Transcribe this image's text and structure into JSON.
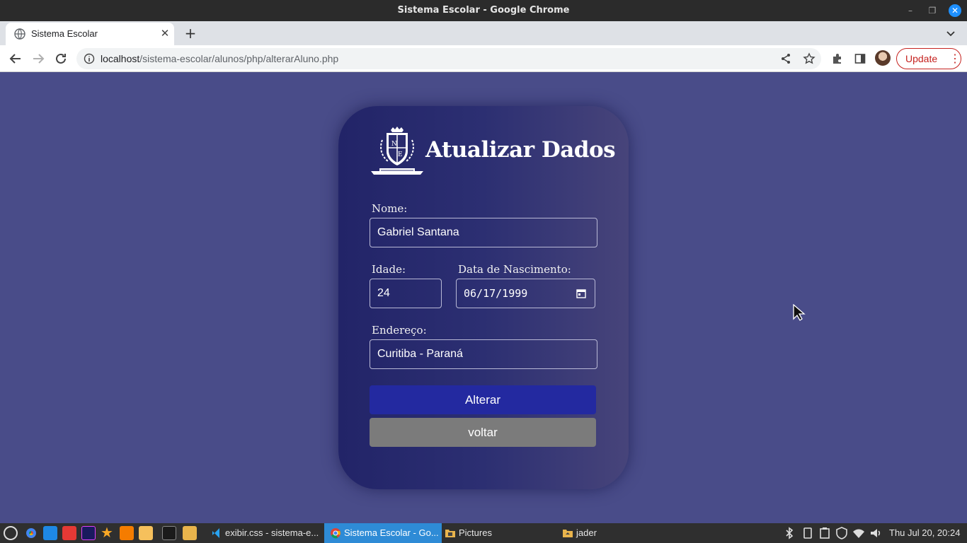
{
  "window": {
    "title": "Sistema Escolar - Google Chrome"
  },
  "browser": {
    "tab_title": "Sistema Escolar",
    "url_host": "localhost",
    "url_path": "/sistema-escolar/alunos/php/alterarAluno.php",
    "update_label": "Update"
  },
  "form": {
    "heading": "Atualizar Dados",
    "nome_label": "Nome:",
    "nome_value": "Gabriel Santana",
    "idade_label": "Idade:",
    "idade_value": "24",
    "nascimento_label": "Data de Nascimento:",
    "nascimento_value": "06/17/1999",
    "endereco_label": "Endereço:",
    "endereco_value": "Curitiba - Paraná",
    "submit_label": "Alterar",
    "back_label": "voltar"
  },
  "taskbar": {
    "tasks": [
      {
        "label": "exibir.css - sistema-e...",
        "icon": "vscode-icon"
      },
      {
        "label": "Sistema Escolar - Go...",
        "icon": "chrome-icon"
      },
      {
        "label": "Pictures",
        "icon": "folder-icon"
      },
      {
        "label": "jader",
        "icon": "folder-icon"
      }
    ],
    "clock": "Thu Jul 20, 20:24"
  },
  "colors": {
    "page_bg": "#494c89",
    "primary_button": "#2329a0",
    "secondary_button": "#7b7b7b",
    "update_accent": "#c5221f"
  }
}
